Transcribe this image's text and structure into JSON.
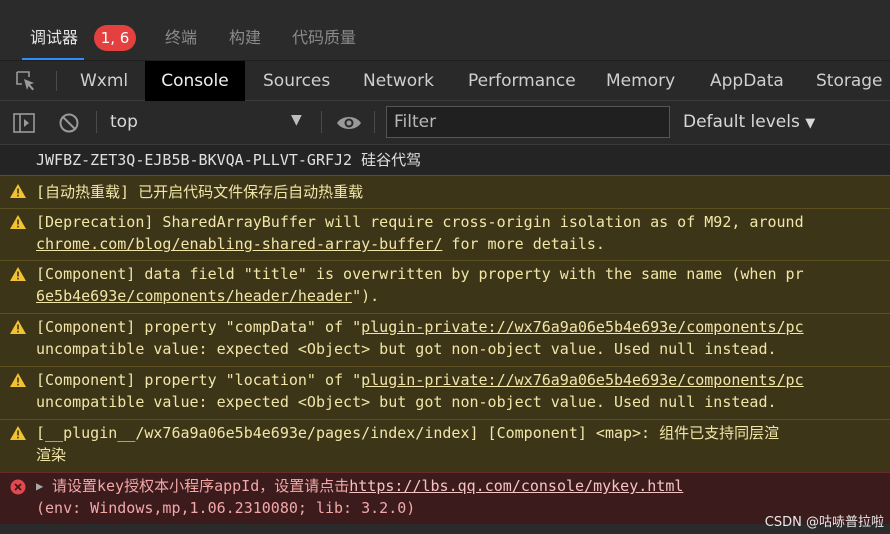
{
  "panel_tabs": {
    "debugger": "调试器",
    "badge": "1, 6",
    "terminal": "终端",
    "build": "构建",
    "code_quality": "代码质量"
  },
  "devtools_tabs": [
    "Wxml",
    "Console",
    "Sources",
    "Network",
    "Performance",
    "Memory",
    "AppData",
    "Storage"
  ],
  "toolbar": {
    "context": "top",
    "filter_placeholder": "Filter",
    "levels": "Default levels"
  },
  "console": {
    "key_line": "JWFBZ-ZET3Q-EJB5B-BKVQA-PLLVT-GRFJ2 硅谷代驾",
    "warn1": "[自动热重载] 已开启代码文件保存后自动热重载",
    "warn2_a": "[Deprecation] SharedArrayBuffer will require cross-origin isolation as of M92, around",
    "warn2_link": "chrome.com/blog/enabling-shared-array-buffer/",
    "warn2_b": " for more details.",
    "warn3_a": "[Component] data field \"title\" is overwritten by property with the same name (when pr",
    "warn3_link": "6e5b4e693e/components/header/header",
    "warn3_b": "\").",
    "warn4_a": "[Component] property \"compData\" of \"",
    "warn4_link": "plugin-private://wx76a9a06e5b4e693e/components/pc",
    "warn4_b": "uncompatible value: expected <Object> but got non-object value. Used null instead.",
    "warn5_a": "[Component] property \"location\" of \"",
    "warn5_link": "plugin-private://wx76a9a06e5b4e693e/components/pc",
    "warn5_b": "uncompatible value: expected <Object> but got non-object value. Used null instead.",
    "warn6_a": "[__plugin__/wx76a9a06e5b4e693e/pages/index/index] [Component] <map>: 组件已支持同层渲",
    "warn6_b": "渲染",
    "err_a": "请设置key授权本小程序appId，设置请点击",
    "err_link": "https://lbs.qq.com/console/mykey.html",
    "err_b": "(env: Windows,mp,1.06.2310080; lib: 3.2.0)"
  },
  "watermark": "CSDN @咕哧普拉啦",
  "colors": {
    "badge": "#e3413f",
    "active_underline": "#2f8df7",
    "warning_bg": "#3d3518",
    "error_bg": "#3c1b1d"
  }
}
